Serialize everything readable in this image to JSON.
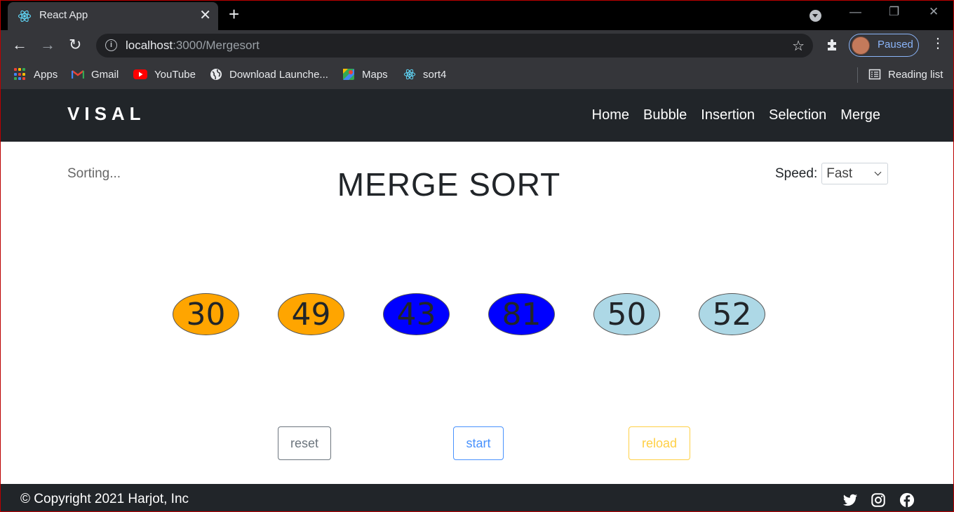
{
  "browser": {
    "tab_title": "React App",
    "url_host": "localhost",
    "url_path": ":3000/Mergesort",
    "profile_status": "Paused",
    "reading_list": "Reading list",
    "bookmarks": [
      {
        "label": "Apps",
        "icon": "apps-grid-icon"
      },
      {
        "label": "Gmail",
        "icon": "gmail-icon"
      },
      {
        "label": "YouTube",
        "icon": "youtube-icon"
      },
      {
        "label": "Download Launche...",
        "icon": "globe-icon"
      },
      {
        "label": "Maps",
        "icon": "maps-icon"
      },
      {
        "label": "sort4",
        "icon": "react-icon"
      }
    ]
  },
  "navbar": {
    "brand": "VISAL",
    "links": [
      "Home",
      "Bubble",
      "Insertion",
      "Selection",
      "Merge"
    ]
  },
  "main": {
    "status": "Sorting...",
    "title": "MERGE SORT",
    "speed_label": "Speed:",
    "speed_value": "Fast",
    "nodes": [
      {
        "value": "30",
        "color": "#ffa500"
      },
      {
        "value": "49",
        "color": "#ffa500"
      },
      {
        "value": "43",
        "color": "#0000ff"
      },
      {
        "value": "81",
        "color": "#0000ff"
      },
      {
        "value": "50",
        "color": "#add8e6"
      },
      {
        "value": "52",
        "color": "#add8e6"
      }
    ],
    "buttons": {
      "reset": "reset",
      "start": "start",
      "reload": "reload"
    }
  },
  "footer": {
    "copyright": "© Copyright 2021 Harjot, Inc",
    "social_icons": [
      "twitter-icon",
      "instagram-icon",
      "facebook-icon"
    ]
  }
}
